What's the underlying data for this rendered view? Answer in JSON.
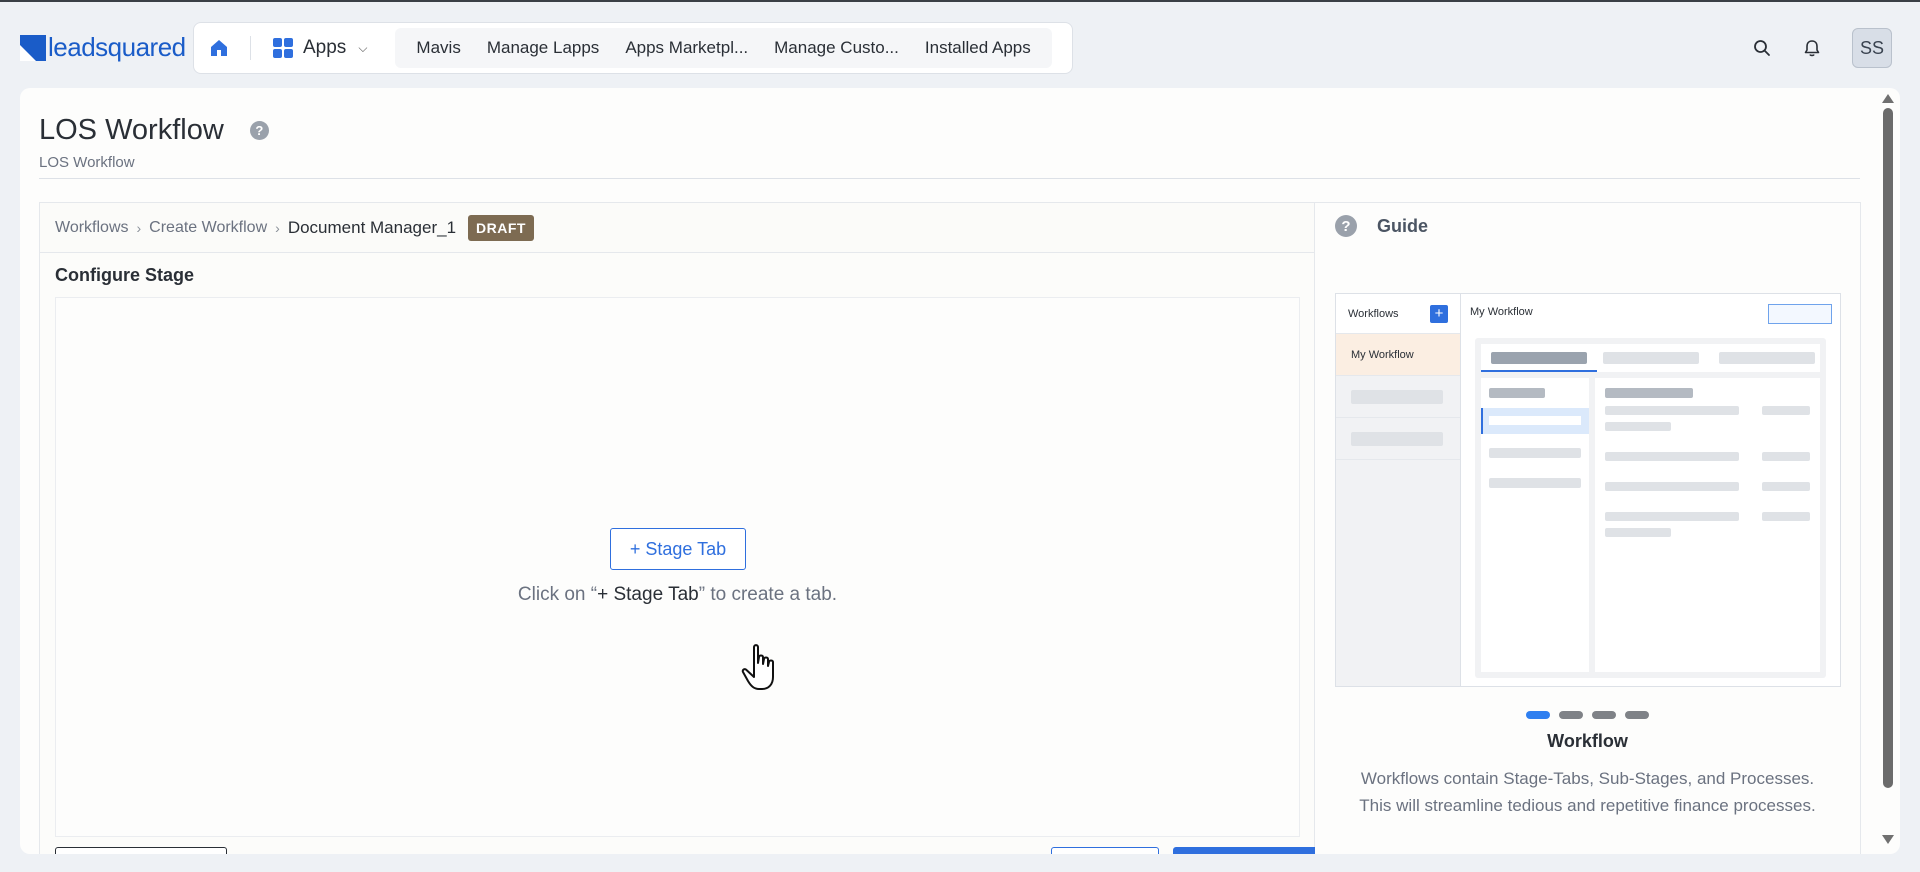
{
  "header": {
    "logo_text": "leadsquared",
    "apps_label": "Apps",
    "nav_tabs": [
      "Mavis",
      "Manage Lapps",
      "Apps Marketpl...",
      "Manage Custo...",
      "Installed Apps"
    ],
    "avatar_initials": "SS",
    "accent_color": "#2f6fde"
  },
  "page": {
    "title": "LOS Workflow",
    "subtitle": "LOS Workflow"
  },
  "breadcrumb": {
    "items": [
      "Workflows",
      "Create Workflow"
    ],
    "current": "Document Manager_1",
    "status_badge": "DRAFT"
  },
  "configure": {
    "title": "Configure Stage",
    "stage_tab_button": "+ Stage Tab",
    "hint_prefix": "Click on “",
    "hint_emphasis": "+ Stage Tab",
    "hint_suffix": "” to create a tab."
  },
  "guide": {
    "title": "Guide",
    "preview": {
      "sidebar_title": "Workflows",
      "selected_item": "My Workflow",
      "main_title": "My Workflow"
    },
    "carousel_count": 4,
    "carousel_active": 1,
    "slide_title": "Workflow",
    "slide_description": "Workflows contain Stage-Tabs, Sub-Stages, and Processes. This will streamline tedious and repetitive finance processes."
  }
}
